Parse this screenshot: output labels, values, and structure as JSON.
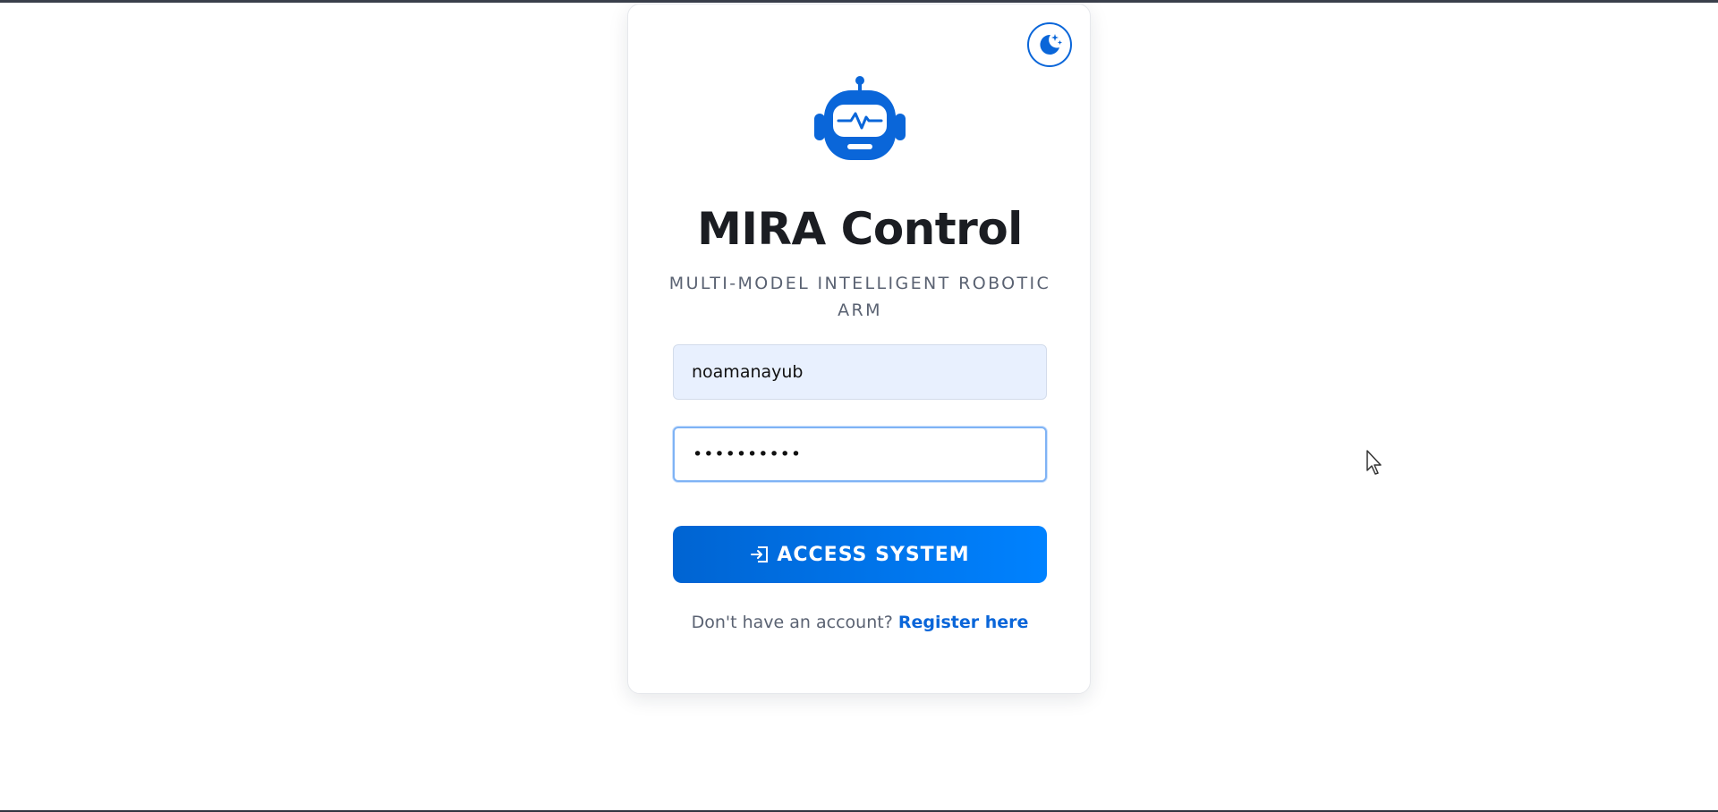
{
  "app": {
    "title": "MIRA Control",
    "subtitle": "MULTI-MODEL INTELLIGENT ROBOTIC ARM"
  },
  "theme_toggle": {
    "icon": "moon-stars-icon"
  },
  "logo": {
    "icon": "robot-icon"
  },
  "login_form": {
    "username_value": "noamanayub",
    "password_value": "••••••••••",
    "submit_label": "ACCESS SYSTEM",
    "submit_icon": "login-arrow-icon"
  },
  "register": {
    "prompt": "Don't have an account?",
    "link_label": "Register here"
  },
  "colors": {
    "accent": "#0a66d9",
    "button_gradient_start": "#0064d2",
    "button_gradient_end": "#0082ff",
    "title_text": "#1b1d22",
    "muted_text": "#5a6272",
    "autofill_bg": "#e8f0fe"
  }
}
